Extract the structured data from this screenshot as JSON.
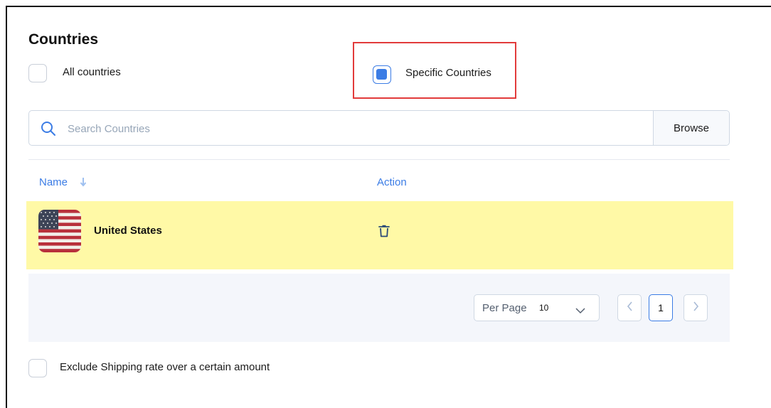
{
  "section": {
    "title": "Countries"
  },
  "scope": {
    "all_label": "All countries",
    "specific_label": "Specific Countries",
    "all_checked": false,
    "specific_checked": true
  },
  "search": {
    "placeholder": "Search Countries",
    "value": "",
    "browse_label": "Browse"
  },
  "table": {
    "columns": [
      "Name",
      "Action"
    ],
    "rows": [
      {
        "name": "United States",
        "flag_icon": "us-flag-icon",
        "action_icon": "trash-icon"
      }
    ]
  },
  "pagination": {
    "per_page_label": "Per Page",
    "per_page_value": "10",
    "current_page": "1"
  },
  "exclude": {
    "label": "Exclude Shipping rate over a certain amount",
    "checked": false
  },
  "colors": {
    "accent": "#3b7ce5",
    "row_highlight": "#fff9a6",
    "annotation_red": "#e23b3b"
  }
}
